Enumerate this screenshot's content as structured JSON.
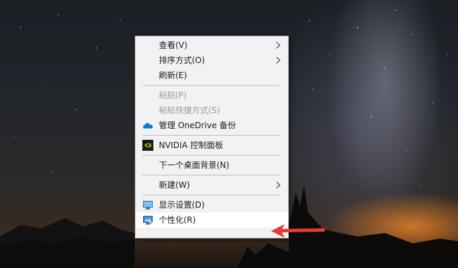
{
  "menu": {
    "items": [
      {
        "label": "查看(V)",
        "submenu": true
      },
      {
        "label": "排序方式(O)",
        "submenu": true
      },
      {
        "label": "刷新(E)"
      },
      {
        "label": "粘贴(P)",
        "disabled": true
      },
      {
        "label": "粘贴快捷方式(S)",
        "disabled": true
      },
      {
        "label": "管理 OneDrive 备份",
        "icon": "onedrive-cloud-icon"
      },
      {
        "label": "NVIDIA 控制面板",
        "icon": "nvidia-icon"
      },
      {
        "label": "下一个桌面背景(N)"
      },
      {
        "label": "新建(W)",
        "submenu": true
      },
      {
        "label": "显示设置(D)",
        "icon": "display-monitor-icon"
      },
      {
        "label": "个性化(R)",
        "icon": "personalize-monitor-icon",
        "highlighted": true
      }
    ]
  },
  "annotation": {
    "arrow_color": "#e8393a",
    "points_to": "个性化(R)"
  },
  "colors": {
    "menu_bg": "#f2f2f2",
    "separator": "#bdbdbd",
    "disabled_text": "#9a9a9a",
    "onedrive": "#0f78d4",
    "nvidia": "#76b900"
  }
}
